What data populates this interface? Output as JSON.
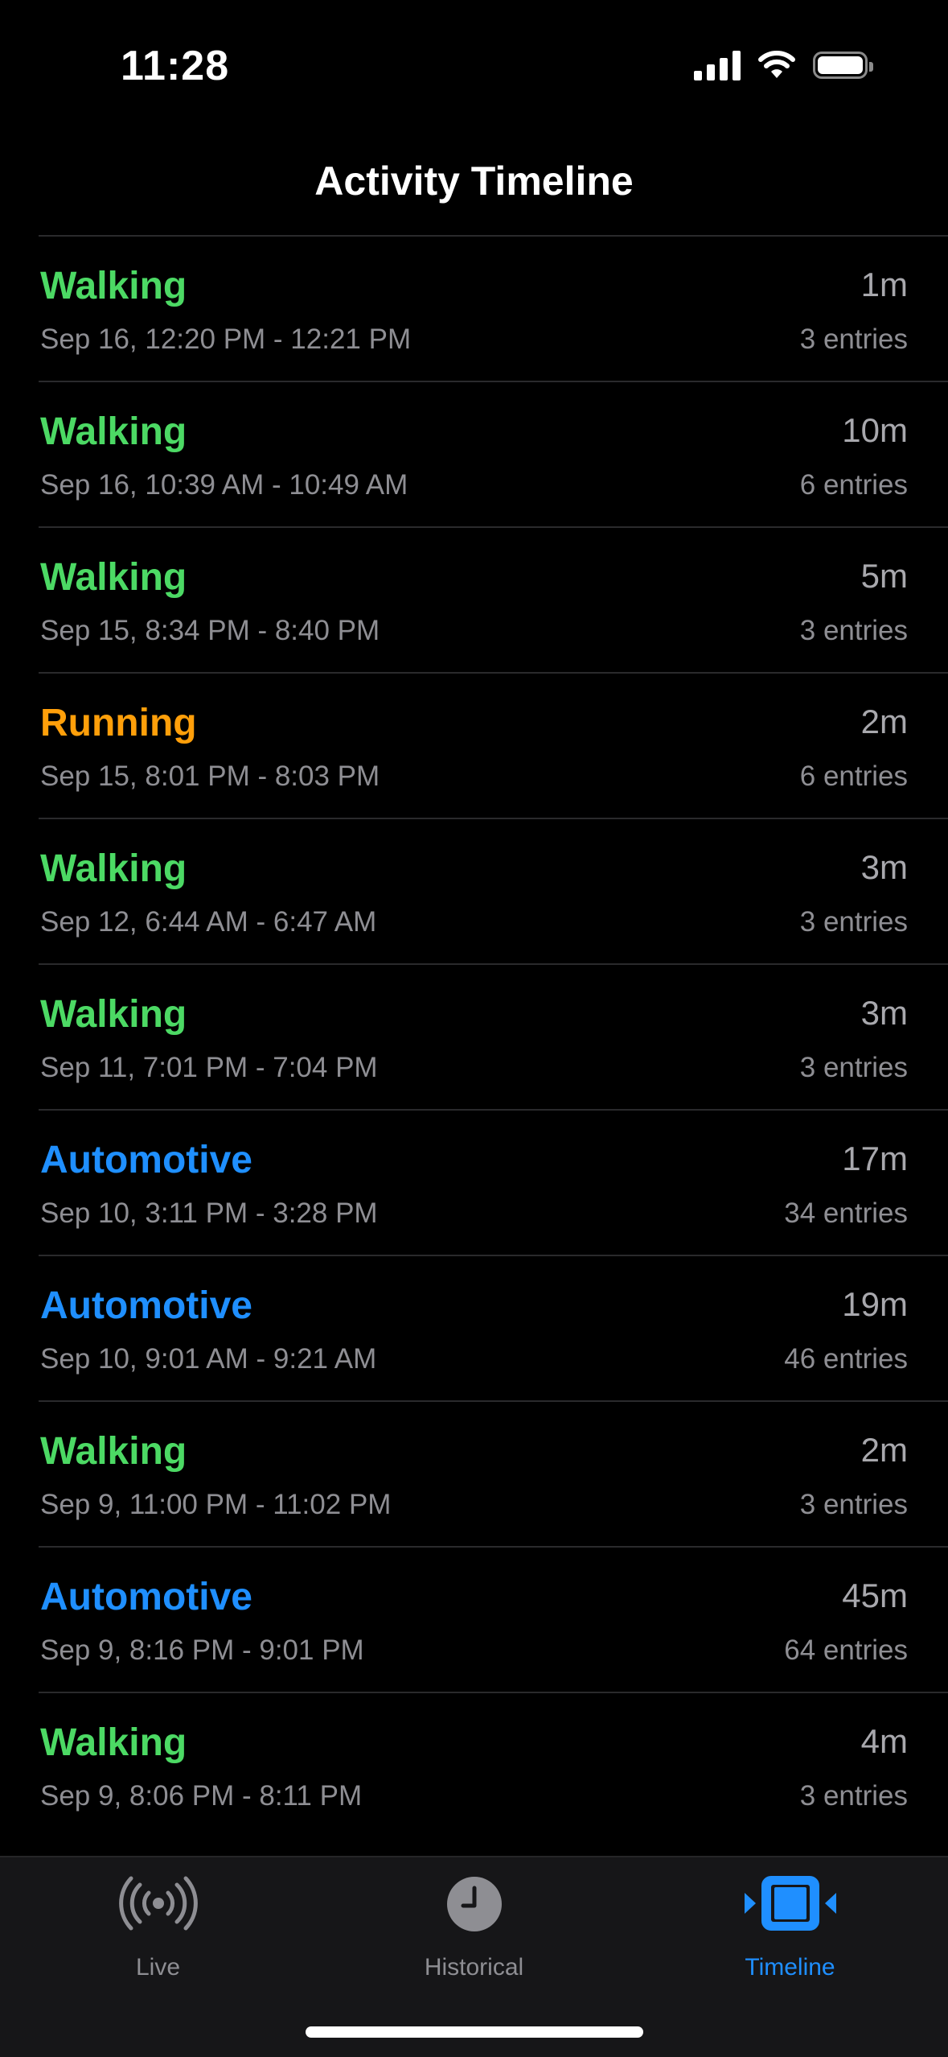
{
  "status_bar": {
    "time": "11:28"
  },
  "nav": {
    "title": "Activity Timeline"
  },
  "colors": {
    "walking": "#4cd964",
    "running": "#ff9f0a",
    "automotive": "#1f8fff",
    "accent": "#1f8fff"
  },
  "timeline": {
    "items": [
      {
        "activity": "Walking",
        "type": "walking",
        "range": "Sep 16, 12:20 PM - 12:21 PM",
        "duration": "1m",
        "entries": "3 entries"
      },
      {
        "activity": "Walking",
        "type": "walking",
        "range": "Sep 16, 10:39 AM - 10:49 AM",
        "duration": "10m",
        "entries": "6 entries"
      },
      {
        "activity": "Walking",
        "type": "walking",
        "range": "Sep 15, 8:34 PM - 8:40 PM",
        "duration": "5m",
        "entries": "3 entries"
      },
      {
        "activity": "Running",
        "type": "running",
        "range": "Sep 15, 8:01 PM - 8:03 PM",
        "duration": "2m",
        "entries": "6 entries"
      },
      {
        "activity": "Walking",
        "type": "walking",
        "range": "Sep 12, 6:44 AM - 6:47 AM",
        "duration": "3m",
        "entries": "3 entries"
      },
      {
        "activity": "Walking",
        "type": "walking",
        "range": "Sep 11, 7:01 PM - 7:04 PM",
        "duration": "3m",
        "entries": "3 entries"
      },
      {
        "activity": "Automotive",
        "type": "automotive",
        "range": "Sep 10, 3:11 PM - 3:28 PM",
        "duration": "17m",
        "entries": "34 entries"
      },
      {
        "activity": "Automotive",
        "type": "automotive",
        "range": "Sep 10, 9:01 AM - 9:21 AM",
        "duration": "19m",
        "entries": "46 entries"
      },
      {
        "activity": "Walking",
        "type": "walking",
        "range": "Sep 9, 11:00 PM - 11:02 PM",
        "duration": "2m",
        "entries": "3 entries"
      },
      {
        "activity": "Automotive",
        "type": "automotive",
        "range": "Sep 9, 8:16 PM - 9:01 PM",
        "duration": "45m",
        "entries": "64 entries"
      },
      {
        "activity": "Walking",
        "type": "walking",
        "range": "Sep 9, 8:06 PM - 8:11 PM",
        "duration": "4m",
        "entries": "3 entries"
      }
    ]
  },
  "tab_bar": {
    "tabs": [
      {
        "label": "Live",
        "icon": "broadcast-icon",
        "active": false
      },
      {
        "label": "Historical",
        "icon": "clock-icon",
        "active": false
      },
      {
        "label": "Timeline",
        "icon": "timeline-icon",
        "active": true
      }
    ]
  }
}
